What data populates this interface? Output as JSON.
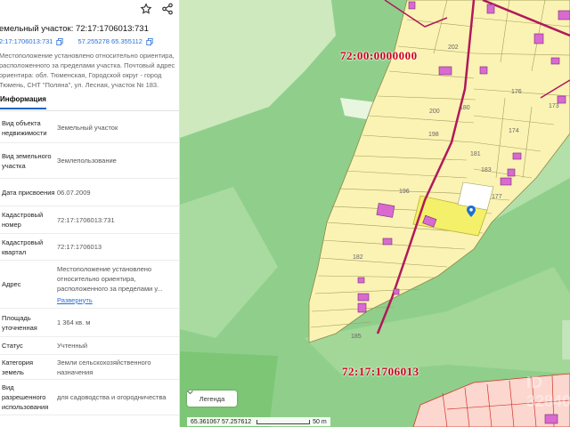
{
  "panel": {
    "title": "емельный участок: 72:17:1706013:731",
    "cadastral_short": "2:17:1706013:731",
    "coordinates": "57.255278 65.355112",
    "location_note": "Местоположение установлено относительно ориентира, расположенного за пределами участка. Почтовый адрес ориентира: обл. Тюменская, Городской округ - город Тюмень, СНТ \"Поляна\", ул. Лесная, участок № 183.",
    "tab_label": "Информация",
    "rows": [
      {
        "key": "Вид объекта недвижимости",
        "value": "Земельный участок"
      },
      {
        "key": "Вид земельного участка",
        "value": "Землепользование"
      },
      {
        "key": "Дата присвоения",
        "value": "06.07.2009"
      },
      {
        "key": "Кадастровый номер",
        "value": "72:17:1706013:731"
      },
      {
        "key": "Кадастровый квартал",
        "value": "72:17:1706013"
      },
      {
        "key": "Адрес",
        "value": "Местоположение установлено относительно ориентира, расположенного за пределами у...",
        "link": "Развернуть"
      },
      {
        "key": "Площадь уточненная",
        "value": "1 364 кв. м"
      },
      {
        "key": "Статус",
        "value": "Учтенный"
      },
      {
        "key": "Категория земель",
        "value": "Земли сельскохозяйственного назначения"
      },
      {
        "key": "Вид разрешенного использования",
        "value": "для садоводства и огородничества"
      }
    ]
  },
  "map": {
    "label_district": "72:00:0000000",
    "label_quarter": "72:17:1706013",
    "legend_label": "Легенда",
    "cursor_coords": "65.361067  57.257612",
    "scale_label": "50 m",
    "watermark": "Циан",
    "watermark_id": "ID 32840",
    "plot_numbers": [
      "202",
      "200",
      "198",
      "196",
      "182",
      "180",
      "176",
      "174",
      "173",
      "177",
      "181",
      "183",
      "185"
    ],
    "colors": {
      "forest": "#8fcf8b",
      "forest_light": "#c8e6b5",
      "plots": "#fbf3b4",
      "selected_plot": "#f5f06a",
      "building": "#d86ad0",
      "road": "#b0195a",
      "label": "#d0021b",
      "lower_plots": "#fbd7cf"
    }
  }
}
